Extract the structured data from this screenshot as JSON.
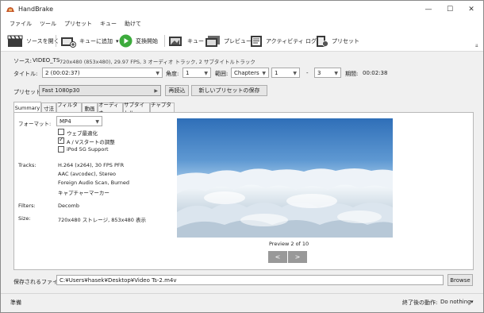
{
  "window": {
    "title": "HandBrake",
    "minimize": "—",
    "maximize": "☐",
    "close": "✕"
  },
  "menu": [
    "ファイル",
    "ツール",
    "プリセット",
    "キュー",
    "助けて"
  ],
  "toolbar": {
    "open_source": "ソースを開く",
    "add_to_queue": "キューに追加",
    "add_to_queue_arrow": "▾",
    "start": "変換開始",
    "queue": "キュー",
    "preview": "プレビュー",
    "activity": "アクティビティ ログ",
    "presets": "プリセット"
  },
  "source": {
    "label": "ソース:",
    "name": "VIDEO_TS",
    "info": "720x480 (853x480), 29.97 FPS, 3 オーディオ トラック, 2 サブタイトルトラック"
  },
  "title_row": {
    "title_label": "タイトル:",
    "title_value": "2 (00:02:37)",
    "angle_label": "角度:",
    "angle_value": "1",
    "range_label": "範囲:",
    "range_type": "Chapters",
    "range_start": "1",
    "range_dash": "-",
    "range_end": "3",
    "duration_label": "期間:",
    "duration_value": "00:02:38"
  },
  "preset_row": {
    "label": "プリセット",
    "value": "Fast 1080p30",
    "reload": "再読込",
    "save_new": "新しいプリセットの保存"
  },
  "tabs": [
    "Summary",
    "寸法",
    "フィルター",
    "動画",
    "オーディオ",
    "サブタイトル",
    "チャプター"
  ],
  "summary": {
    "format_label": "フォーマット:",
    "format_value": "MP4",
    "options": [
      {
        "label": "ウェブ最適化",
        "checked": false
      },
      {
        "label": "A / Vスタートの調整",
        "checked": true
      },
      {
        "label": "iPod 5G Support",
        "checked": false
      }
    ],
    "tracks_label": "Tracks:",
    "tracks": [
      "H.264 (x264), 30 FPS PFR",
      "AAC (avcodec), Stereo",
      "Foreign Audio Scan, Burned",
      "キャプチャーマーカー"
    ],
    "filters_label": "Filters:",
    "filters_value": "Decomb",
    "size_label": "Size:",
    "size_value": "720x480 ストレージ, 853x480 表示",
    "preview_caption": "Preview 2 of 10",
    "prev_button": "<",
    "next_button": ">"
  },
  "destination": {
    "label": "保存されるファイル:",
    "path": "C:¥Users¥hasek¥Desktop¥Video Ts-2.m4v",
    "browse": "Browse"
  },
  "status": {
    "text": "準備",
    "after_label": "終了後の動作:",
    "after_value": "Do nothing",
    "after_arrow": "▾"
  },
  "colors": {
    "sky_top": "#2f6fb8",
    "sky_bottom": "#a9cdea",
    "start_green": "#3cab3c",
    "nav_button": "#999999"
  },
  "icons": [
    "handbrake-app-icon",
    "film-clapper-icon",
    "add-queue-icon",
    "play-icon",
    "queue-icon",
    "preview-icon",
    "activity-log-icon",
    "presets-icon"
  ]
}
